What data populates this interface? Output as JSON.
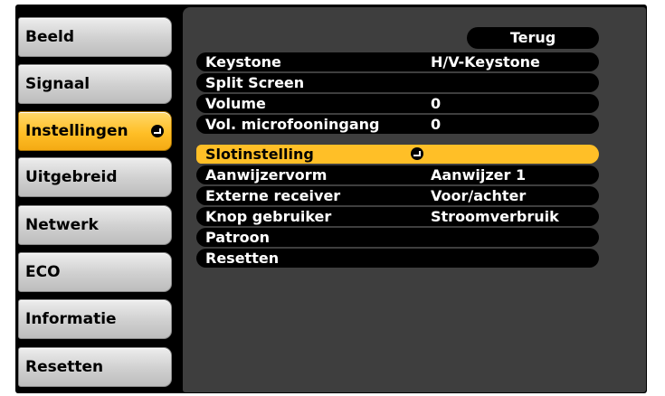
{
  "sidebar": {
    "items": [
      {
        "label": "Beeld"
      },
      {
        "label": "Signaal"
      },
      {
        "label": "Instellingen"
      },
      {
        "label": "Uitgebreid"
      },
      {
        "label": "Netwerk"
      },
      {
        "label": "ECO"
      },
      {
        "label": "Informatie"
      },
      {
        "label": "Resetten"
      }
    ],
    "active_index": 2
  },
  "main": {
    "back_label": "Terug",
    "rows": [
      {
        "label": "Keystone",
        "value": "H/V-Keystone"
      },
      {
        "label": "Split Screen",
        "value": ""
      },
      {
        "label": "Volume",
        "value": "0"
      },
      {
        "label": "Vol. microfooningang",
        "value": "0"
      },
      {
        "label": "Slotinstelling",
        "value": ""
      },
      {
        "label": "Aanwijzervorm",
        "value": "Aanwijzer 1"
      },
      {
        "label": "Externe receiver",
        "value": "Voor/achter"
      },
      {
        "label": "Knop gebruiker",
        "value": "Stroomverbruik"
      },
      {
        "label": "Patroon",
        "value": ""
      },
      {
        "label": "Resetten",
        "value": ""
      }
    ],
    "selected_index": 4
  },
  "colors": {
    "highlight": "#ffbf27",
    "panel": "#3e3e3e",
    "background": "#000000"
  },
  "icons": {
    "enter": "enter-icon"
  }
}
